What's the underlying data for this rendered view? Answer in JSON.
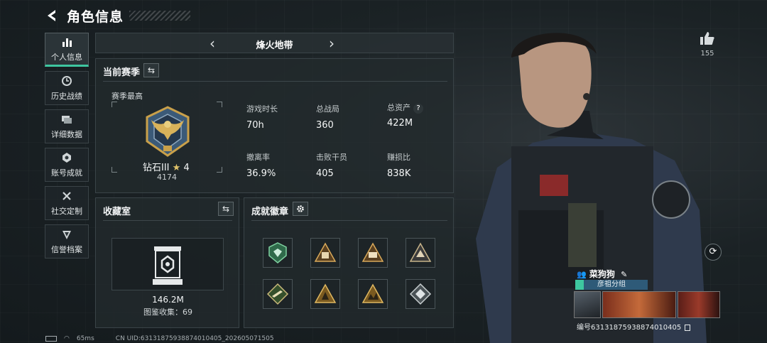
{
  "header": {
    "title": "角色信息",
    "back_icon": "back-arrow-icon"
  },
  "sidebar": {
    "items": [
      {
        "label": "个人信息",
        "icon": "bar-chart-icon",
        "active": true
      },
      {
        "label": "历史战绩",
        "icon": "history-clock-icon"
      },
      {
        "label": "详细数据",
        "icon": "details-cards-icon"
      },
      {
        "label": "账号成就",
        "icon": "achievement-badge-icon"
      },
      {
        "label": "社交定制",
        "icon": "tools-cross-icon"
      },
      {
        "label": "信誉档案",
        "icon": "shield-diamond-icon"
      }
    ]
  },
  "mode": {
    "name": "烽火地带"
  },
  "season": {
    "title": "当前赛季",
    "best_label": "赛季最高",
    "rank_name": "钻石III",
    "rank_stars": "4",
    "rank_points": "4174",
    "stats": [
      {
        "label": "游戏时长",
        "value": "70h"
      },
      {
        "label": "总战局",
        "value": "360"
      },
      {
        "label": "总资产",
        "value": "422M",
        "help": "?"
      },
      {
        "label": "撤离率",
        "value": "36.9%"
      },
      {
        "label": "击败干员",
        "value": "405"
      },
      {
        "label": "赚损比",
        "value": "838K"
      }
    ]
  },
  "collection": {
    "title": "收藏室",
    "value": "146.2M",
    "progress_label": "图鉴收集：69"
  },
  "achievements": {
    "title": "成就徽章",
    "badges": [
      "green-shield-badge",
      "triangle-badge-1",
      "triangle-badge-2",
      "triangle-badge-3",
      "gun-badge",
      "triangle-badge-4",
      "triangle-badge-5",
      "diamond-badge"
    ]
  },
  "profile": {
    "likes": "155",
    "player_name": "菜狗狗",
    "clan": "彦祖分组",
    "uid_short": "编号63131875938874010405"
  },
  "footer": {
    "ping": "65ms",
    "uid": "CN UID:63131875938874010405_202605071505"
  },
  "colors": {
    "accent": "#3ec6a0",
    "clan_bg": "#2e5a78",
    "badge_gold": "#c9a04a"
  }
}
